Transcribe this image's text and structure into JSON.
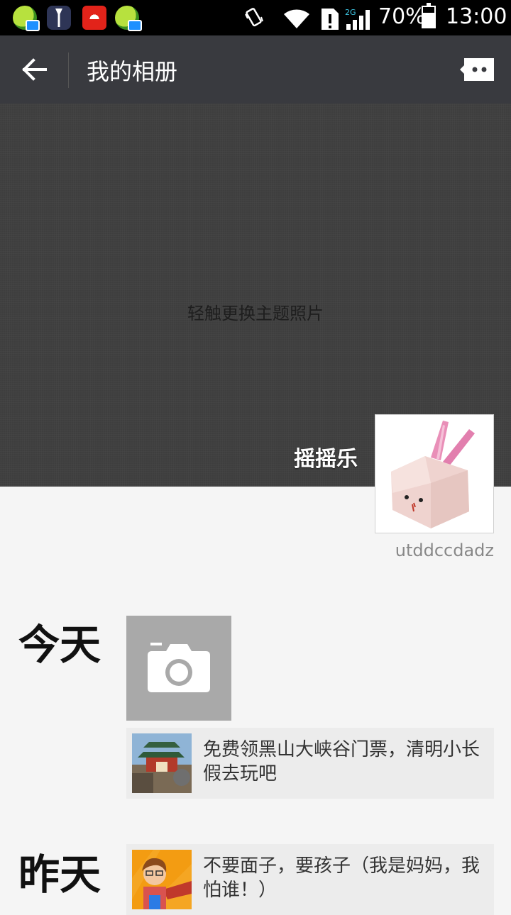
{
  "status_bar": {
    "notifications": [
      "app-plus-mail-icon",
      "tuxedo-app-icon",
      "huawei-app-icon",
      "app-plus-mail-icon"
    ],
    "network": "2G",
    "battery_percent": "70%",
    "battery_level": 0.7,
    "time": "13:00"
  },
  "action_bar": {
    "title": "我的相册"
  },
  "cover": {
    "hint": "轻触更换主题照片",
    "nickname": "摇摇乐",
    "username": "utddccdadz"
  },
  "timeline": [
    {
      "day": "今天",
      "post_text": "免费领黑山大峡谷门票，清明小长假去玩吧"
    },
    {
      "day": "昨天",
      "post_text": "不要面子，要孩子（我是妈妈，我怕谁！）"
    }
  ],
  "colors": {
    "action_bar": "#393a3f",
    "cover": "#3e3e3e",
    "background": "#f5f5f5",
    "camera_tile": "#a9a9a9"
  }
}
